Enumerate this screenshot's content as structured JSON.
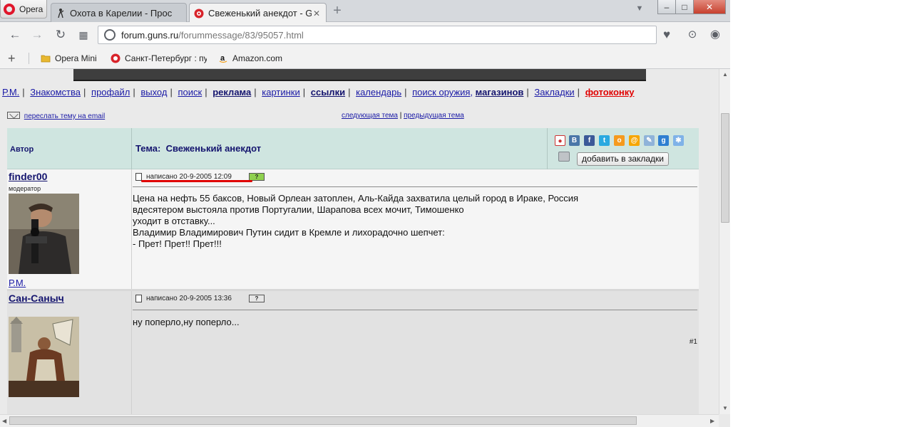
{
  "browser": {
    "menu_label": "Opera",
    "tabs": [
      {
        "title": "Охота в Карелии - Прос",
        "active": false
      },
      {
        "title": "Свеженький анекдот - Gu",
        "active": true
      }
    ],
    "new_tab_glyph": "+",
    "window_controls": [
      "–",
      "□",
      "✕"
    ],
    "address": {
      "host": "forum.guns.ru",
      "path": "/forummessage/83/95057.html"
    },
    "bookmarks": [
      {
        "label": "Opera Mini",
        "icon": "folder-icon"
      },
      {
        "label": "Санкт-Петербург : пу",
        "icon": "forum-favicon"
      },
      {
        "label": "Amazon.com",
        "icon": "amazon-icon"
      }
    ]
  },
  "page": {
    "nav_links": [
      {
        "text": "Р.М.",
        "style": "normal"
      },
      {
        "text": "Знакомства",
        "style": "normal"
      },
      {
        "text": "профайл",
        "style": "normal"
      },
      {
        "text": "выход",
        "style": "normal"
      },
      {
        "text": "поиск",
        "style": "normal"
      },
      {
        "text": "реклама",
        "style": "bold"
      },
      {
        "text": "картинки",
        "style": "normal"
      },
      {
        "text": "ссылки",
        "style": "bold"
      },
      {
        "text": "календарь",
        "style": "normal"
      },
      {
        "text": "поиск оружия,",
        "style": "normal"
      },
      {
        "text": "магазинов",
        "style": "bold"
      },
      {
        "text": "Закладки",
        "style": "normal"
      },
      {
        "text": "фотоконку",
        "style": "red"
      }
    ],
    "forward_label": "переслать тему на email",
    "next_topic": "следующая тема",
    "prev_topic": "предыдущая тема",
    "topic_sep": "|",
    "table_header": {
      "author": "Автор",
      "topic_prefix": "Тема:",
      "topic": "Свеженький анекдот",
      "add_bookmark": "добавить в закладки"
    },
    "posts": [
      {
        "author": "finder00",
        "role": "модератор",
        "author_link": "Р.М.",
        "meta": "написано 20-9-2005 12:09",
        "body": "Цена на нефть 55 баксов, Новый Орлеан затоплен, Аль-Кайда захватила целый город в Ираке, Россия\nвдесятером выстояла против Португалии, Шарапова всех мочит, Тимошенко\nуходит в отставку...\nВладимир Владимирович Путин сидит в Кремле и лихорадочно шепчет:\n- Прет! Прет!! Прет!!!",
        "number": ""
      },
      {
        "author": "Сан-Саныч",
        "role": "",
        "author_link": "",
        "meta": "написано 20-9-2005 13:36",
        "body": "ну поперло,ну поперло...",
        "number": "#1"
      }
    ]
  },
  "colors": {
    "link": "#1a1aa6",
    "header_bg": "#cfe5e0",
    "annotation": "#e00000"
  }
}
